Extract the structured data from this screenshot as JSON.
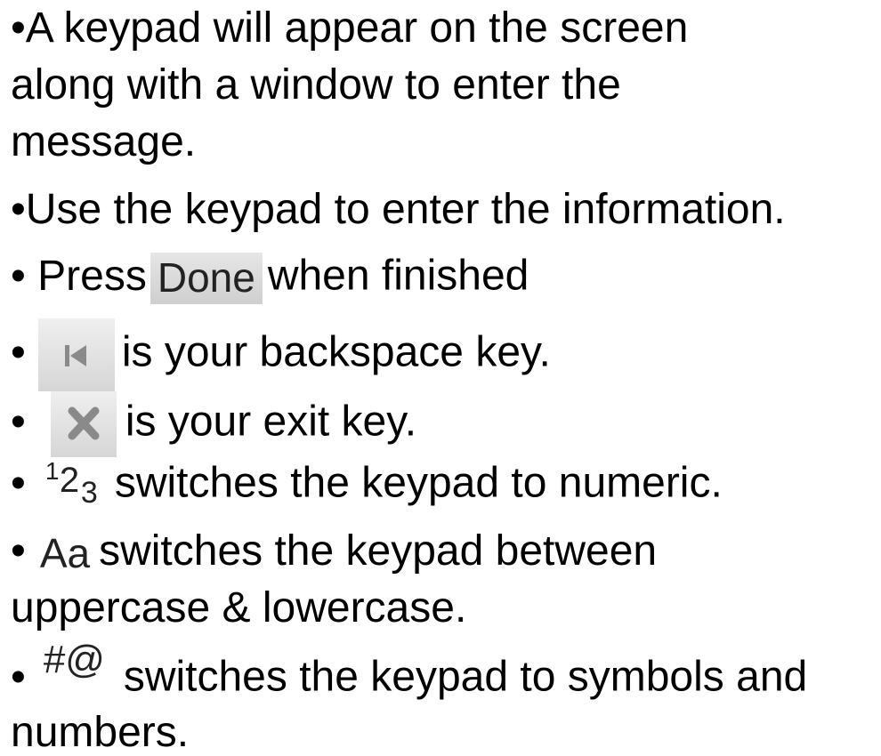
{
  "lines": {
    "l1": "•A keypad will appear on the screen",
    "l2": "along with a window to enter the",
    "l3": "message.",
    "l4": "•Use the keypad to enter the information.",
    "l5_bullet": "• Press",
    "l5_key": "Done",
    "l5_rest": "when finished",
    "l6_bullet": "•",
    "l6_rest": "is your backspace key.",
    "l7_bullet": "•",
    "l7_rest": "is your exit key.",
    "l8_bullet": "•",
    "l8_key_1": "1",
    "l8_key_2": "2",
    "l8_key_3": "3",
    "l8_rest": "switches the keypad to numeric.",
    "l9_bullet": "•",
    "l9_key": "Aa",
    "l9_rest": "switches the keypad between",
    "l10": "uppercase & lowercase.",
    "l11_bullet": "•",
    "l11_key": "#@",
    "l11_rest": "switches the keypad to symbols and",
    "l12": "numbers."
  },
  "icons": {
    "backspace": "backspace-icon",
    "exit": "close-icon"
  },
  "colors": {
    "text": "#000000",
    "key_bg_top": "#efefef",
    "key_bg_bottom": "#d6d6d6",
    "icon_gray": "#8a8a8a"
  }
}
